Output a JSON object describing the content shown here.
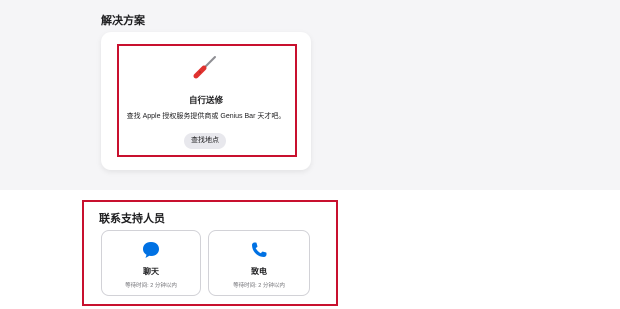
{
  "solutions": {
    "title": "解决方案",
    "card": {
      "icon": "tools-icon",
      "heading": "自行送修",
      "description": "查找 Apple 授权服务提供商或 Genius Bar 天才吧。",
      "button_label": "查找地点"
    }
  },
  "contact": {
    "title": "联系支持人员",
    "options": [
      {
        "icon": "chat-bubble-icon",
        "label": "聊天",
        "wait": "等待时间: 2 分钟以内"
      },
      {
        "icon": "phone-icon",
        "label": "致电",
        "wait": "等待时间: 2 分钟以内"
      }
    ]
  },
  "colors": {
    "page_top_background": "#f5f5f7",
    "highlight": "#c8102e",
    "icon_blue": "#0071e3",
    "tool_red": "#e0322f"
  }
}
